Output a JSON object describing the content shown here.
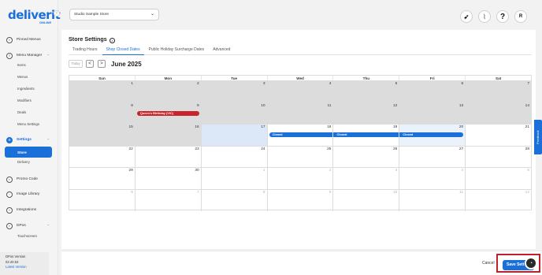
{
  "brand": {
    "logo": "deliverit",
    "sub": "ONLINE"
  },
  "sidebar": {
    "items": [
      {
        "label": "Pinned Menus",
        "icon": "pin-icon"
      },
      {
        "label": "Menu Manager",
        "icon": "menu-icon"
      },
      {
        "label": "Settings",
        "icon": "gear-icon"
      },
      {
        "label": "Promo Code",
        "icon": "tag-icon"
      },
      {
        "label": "Image Library",
        "icon": "image-icon"
      },
      {
        "label": "Integrations",
        "icon": "plug-icon"
      },
      {
        "label": "DPos",
        "icon": "pos-icon"
      }
    ],
    "menu_manager_subs": [
      "Items",
      "Menus",
      "Ingredients",
      "Modifiers",
      "Deals",
      "Menu Settings"
    ],
    "settings_subs": [
      "Store",
      "Delivery"
    ],
    "dpos_subs": [
      "Touchscreen"
    ],
    "active_sub": "Store",
    "version": {
      "label": "DPos Version",
      "number": "02.20.53",
      "link": "Latest Version"
    }
  },
  "header": {
    "store_select": "Studio Sample Store",
    "icons": [
      "rocket-icon",
      "paperclip-icon",
      "help-icon",
      "avatar"
    ],
    "help_glyph": "?",
    "avatar_initial": "R"
  },
  "page": {
    "title": "Store Settings",
    "tabs": [
      "Trading Hours",
      "Shop Closed Dates",
      "Public Holiday Surcharge Dates",
      "Advanced"
    ],
    "active_tab": "Shop Closed Dates"
  },
  "calendar": {
    "today_label": "Today",
    "prev_glyph": "<",
    "next_glyph": ">",
    "month": "June 2025",
    "weekdays": [
      "Sun",
      "Mon",
      "Tue",
      "Wed",
      "Thu",
      "Fri",
      "Sat"
    ],
    "weeks": [
      [
        "1",
        "2",
        "3",
        "4",
        "5",
        "6",
        "7"
      ],
      [
        "8",
        "9",
        "10",
        "11",
        "12",
        "13",
        "14"
      ],
      [
        "15",
        "16",
        "17",
        "18",
        "19",
        "20",
        "21"
      ],
      [
        "22",
        "23",
        "24",
        "25",
        "26",
        "27",
        "28"
      ],
      [
        "29",
        "30",
        "1",
        "2",
        "3",
        "4",
        "5"
      ],
      [
        "6",
        "7",
        "8",
        "9",
        "10",
        "11",
        "12"
      ]
    ],
    "events": [
      {
        "label": "Queen's Birthday (VIC)",
        "color": "#c9232b"
      },
      {
        "label": "Closed",
        "color": "#1a6fd8"
      },
      {
        "label": "Closed",
        "color": "#1a6fd8"
      },
      {
        "label": "Closed",
        "color": "#1a6fd8"
      }
    ],
    "colors": {
      "past": "#dcdcdc",
      "today": "#dce8f7",
      "accent": "#1a6fd8"
    }
  },
  "footer": {
    "cancel": "Cancel",
    "save": "Save Sett"
  },
  "feedback": "Feedback"
}
